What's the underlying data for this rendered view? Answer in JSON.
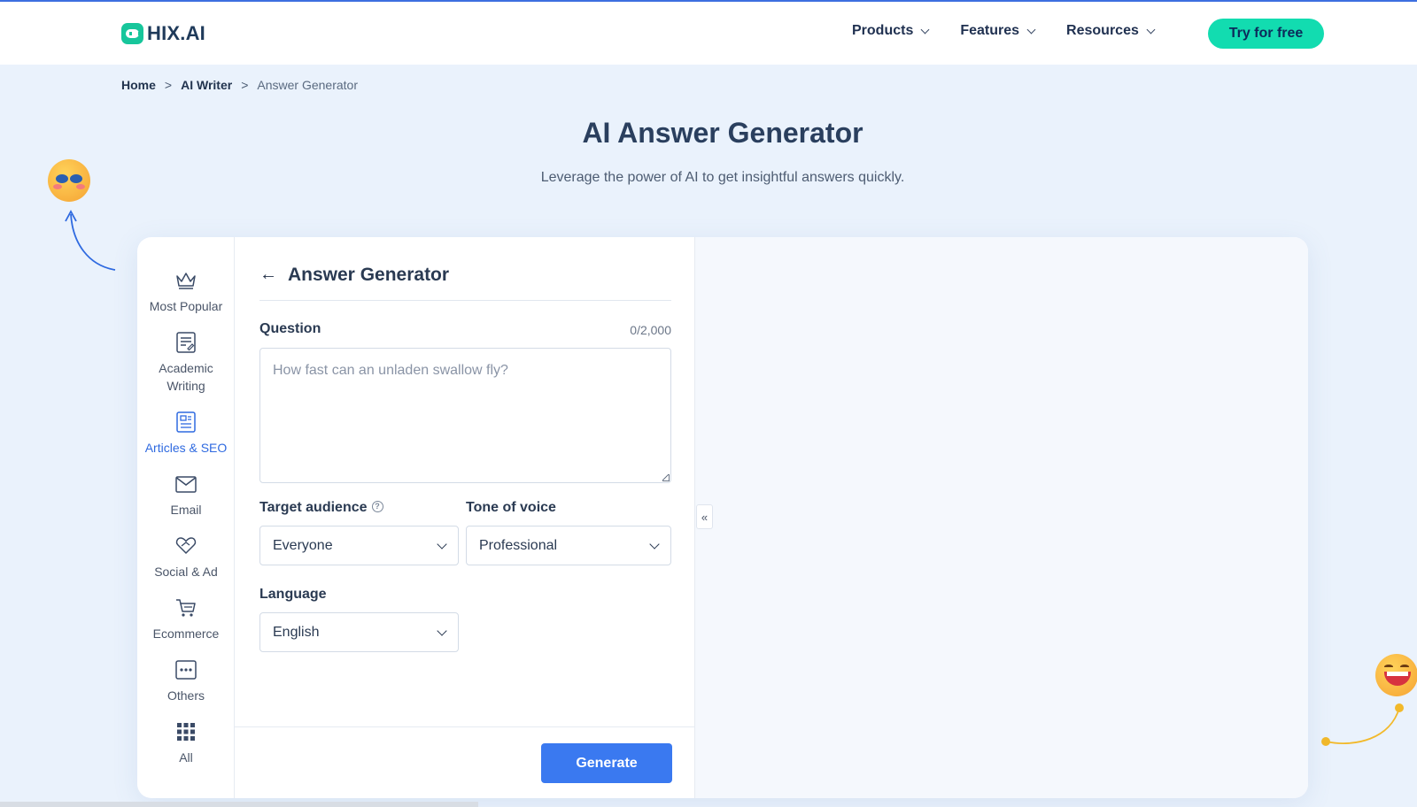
{
  "header": {
    "logo_text": "HIX.AI",
    "nav": [
      {
        "label": "Products"
      },
      {
        "label": "Features"
      },
      {
        "label": "Resources"
      }
    ],
    "cta_label": "Try for free"
  },
  "breadcrumb": {
    "home": "Home",
    "sep": ">",
    "writer": "AI Writer",
    "current": "Answer Generator"
  },
  "hero": {
    "title": "AI Answer Generator",
    "subtitle": "Leverage the power of AI to get insightful answers quickly."
  },
  "sidebar": {
    "items": [
      {
        "label": "Most Popular",
        "icon": "crown-icon"
      },
      {
        "label": "Academic Writing",
        "icon": "document-edit-icon"
      },
      {
        "label": "Articles & SEO",
        "icon": "article-icon",
        "active": true
      },
      {
        "label": "Email",
        "icon": "envelope-icon"
      },
      {
        "label": "Social & Ad",
        "icon": "heart-hand-icon"
      },
      {
        "label": "Ecommerce",
        "icon": "cart-icon"
      },
      {
        "label": "Others",
        "icon": "dots-icon"
      },
      {
        "label": "All",
        "icon": "grid-icon"
      }
    ]
  },
  "form": {
    "title": "Answer Generator",
    "question_label": "Question",
    "question_counter": "0/2,000",
    "question_placeholder": "How fast can an unladen swallow fly?",
    "question_value": "",
    "audience_label": "Target audience",
    "audience_value": "Everyone",
    "tone_label": "Tone of voice",
    "tone_value": "Professional",
    "language_label": "Language",
    "language_value": "English",
    "generate_label": "Generate"
  },
  "output": {
    "collapse_icon": "«"
  },
  "colors": {
    "accent": "#3a79f0",
    "cta": "#12dcb0",
    "background": "#eaf2fc"
  }
}
